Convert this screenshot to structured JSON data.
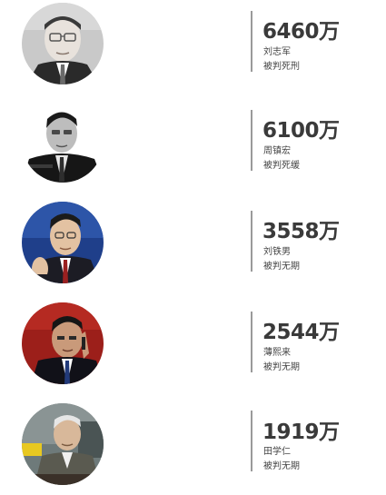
{
  "items": [
    {
      "amount": "6460万",
      "name": "刘志军",
      "verdict": "被判死刑",
      "photo": "portrait-grayscale-glasses"
    },
    {
      "amount": "6100万",
      "name": "周镇宏",
      "verdict": "被判死缓",
      "photo": "portrait-black-white-suit"
    },
    {
      "amount": "3558万",
      "name": "刘铁男",
      "verdict": "被判无期",
      "photo": "portrait-color-blue-background"
    },
    {
      "amount": "2544万",
      "name": "薄熙来",
      "verdict": "被判无期",
      "photo": "portrait-color-red-background-phone"
    },
    {
      "amount": "1919万",
      "name": "田学仁",
      "verdict": "被判无期",
      "photo": "portrait-color-courtroom"
    }
  ],
  "colors": {
    "text": "#333333",
    "divider": "#9a9a9a"
  }
}
